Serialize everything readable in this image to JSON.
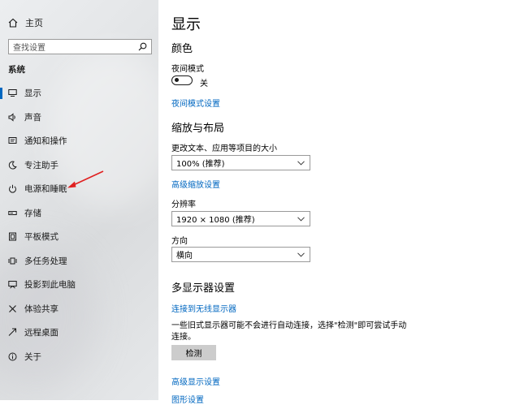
{
  "sidebar": {
    "home_label": "主页",
    "search_placeholder": "查找设置",
    "section_title": "系统",
    "items": [
      {
        "label": "显示",
        "icon": "monitor-icon"
      },
      {
        "label": "声音",
        "icon": "speaker-icon"
      },
      {
        "label": "通知和操作",
        "icon": "notification-icon"
      },
      {
        "label": "专注助手",
        "icon": "moon-icon"
      },
      {
        "label": "电源和睡眠",
        "icon": "power-icon"
      },
      {
        "label": "存储",
        "icon": "storage-icon"
      },
      {
        "label": "平板模式",
        "icon": "tablet-icon"
      },
      {
        "label": "多任务处理",
        "icon": "multitask-icon"
      },
      {
        "label": "投影到此电脑",
        "icon": "project-icon"
      },
      {
        "label": "体验共享",
        "icon": "share-icon"
      },
      {
        "label": "远程桌面",
        "icon": "remote-icon"
      },
      {
        "label": "关于",
        "icon": "info-icon"
      }
    ]
  },
  "main": {
    "title": "显示",
    "color_heading": "颜色",
    "night_light_label": "夜间模式",
    "night_light_state": "关",
    "night_light_settings_link": "夜间模式设置",
    "scale_heading": "缩放与布局",
    "scale_label": "更改文本、应用等项目的大小",
    "scale_value": "100% (推荐)",
    "advanced_scaling_link": "高级缩放设置",
    "resolution_label": "分辨率",
    "resolution_value": "1920 × 1080 (推荐)",
    "orientation_label": "方向",
    "orientation_value": "横向",
    "multi_display_heading": "多显示器设置",
    "wireless_link": "连接到无线显示器",
    "multi_display_desc": "一些旧式显示器可能不会进行自动连接，选择\"检测\"即可尝试手动连接。",
    "detect_button": "检测",
    "advanced_display_link": "高级显示设置",
    "graphics_link_partial": "图形设置"
  },
  "colors": {
    "accent": "#0067c0",
    "annotation_arrow": "#e02020"
  }
}
